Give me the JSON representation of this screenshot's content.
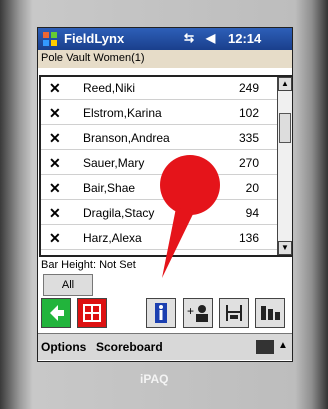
{
  "titlebar": {
    "app_name": "FieldLynx",
    "signal_icon": "signal-icon",
    "volume_icon": "volume-icon",
    "time": "12:14"
  },
  "subheader": {
    "title": "Pole Vault Women(1)"
  },
  "list": {
    "items": [
      {
        "name": "Reed,Niki",
        "number": "249"
      },
      {
        "name": "Elstrom,Karina",
        "number": "102"
      },
      {
        "name": "Branson,Andrea",
        "number": "335"
      },
      {
        "name": "Sauer,Mary",
        "number": "270"
      },
      {
        "name": "Bair,Shae",
        "number": "20"
      },
      {
        "name": "Dragila,Stacy",
        "number": "94"
      },
      {
        "name": "Harz,Alexa",
        "number": "136"
      }
    ]
  },
  "bar_height": "Bar Height: Not Set",
  "all_button": "All",
  "toolbar": {
    "back_icon": "back-arrow-icon",
    "grid_icon": "results-grid-icon",
    "info_icon": "info-icon",
    "add_athlete_icon": "add-athlete-icon",
    "height_icon": "bar-height-icon",
    "stats_icon": "stats-icon"
  },
  "menubar": {
    "options": "Options",
    "scoreboard": "Scoreboard",
    "keyboard_icon": "keyboard-icon"
  },
  "device": {
    "brand": "iPAQ"
  },
  "colors": {
    "titlebar": "#1f4aa0",
    "marker": "#e5141a",
    "back_green": "#22b43c"
  }
}
